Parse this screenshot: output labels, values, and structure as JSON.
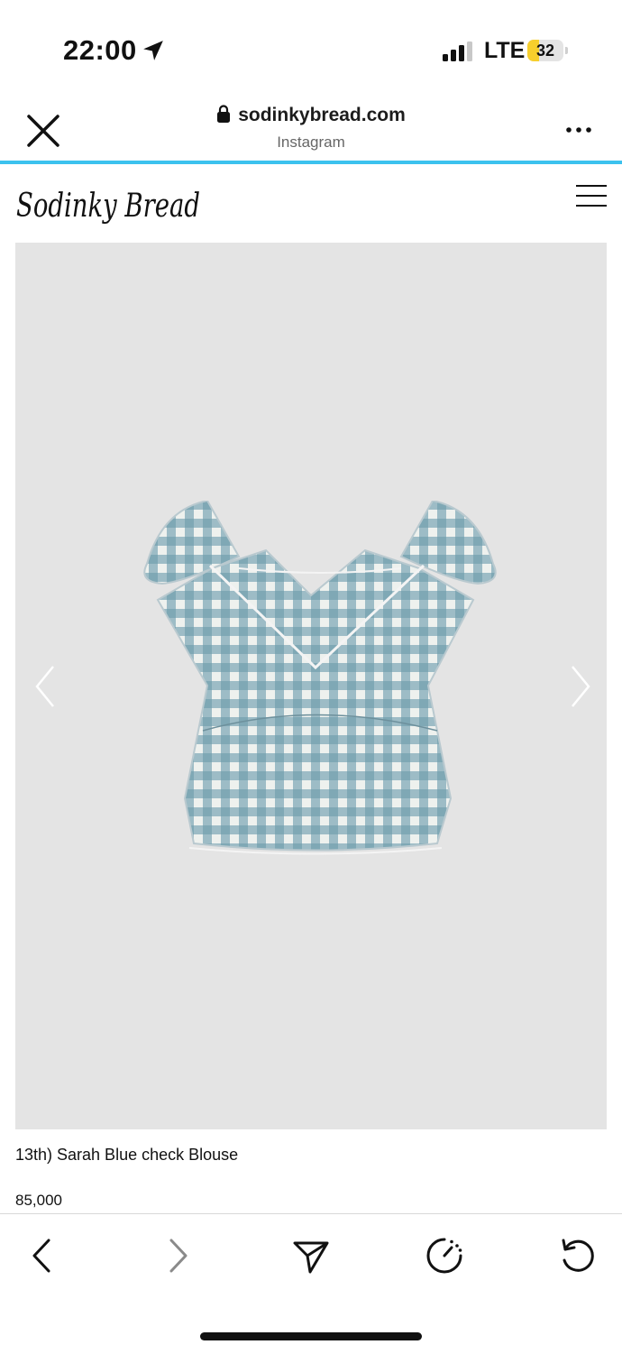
{
  "status_bar": {
    "time": "22:00",
    "network": "LTE",
    "battery_level": "32",
    "battery_fraction": 0.32,
    "icons": [
      "location-arrow-icon",
      "cellular-signal-icon",
      "battery-icon"
    ]
  },
  "browser": {
    "url": "sodinkybread.com",
    "source_label": "Instagram",
    "progress_color": "#3cc2ee",
    "icons": [
      "close-icon",
      "lock-icon",
      "more-dots-icon"
    ]
  },
  "site": {
    "logo_text": "Sodinky Bread",
    "icons": [
      "hamburger-menu-icon"
    ]
  },
  "product": {
    "name": "13th) Sarah Blue check Blouse",
    "price": "85,000",
    "image_background": "#e4e4e4",
    "gingham_colors": [
      "#7fa8b5",
      "#eef1ee"
    ],
    "icons": [
      "chevron-left-icon",
      "chevron-right-icon"
    ]
  },
  "toolbar": {
    "icons": [
      "back-arrow-icon",
      "forward-arrow-icon",
      "share-send-icon",
      "speed-timer-icon",
      "refresh-icon"
    ]
  }
}
